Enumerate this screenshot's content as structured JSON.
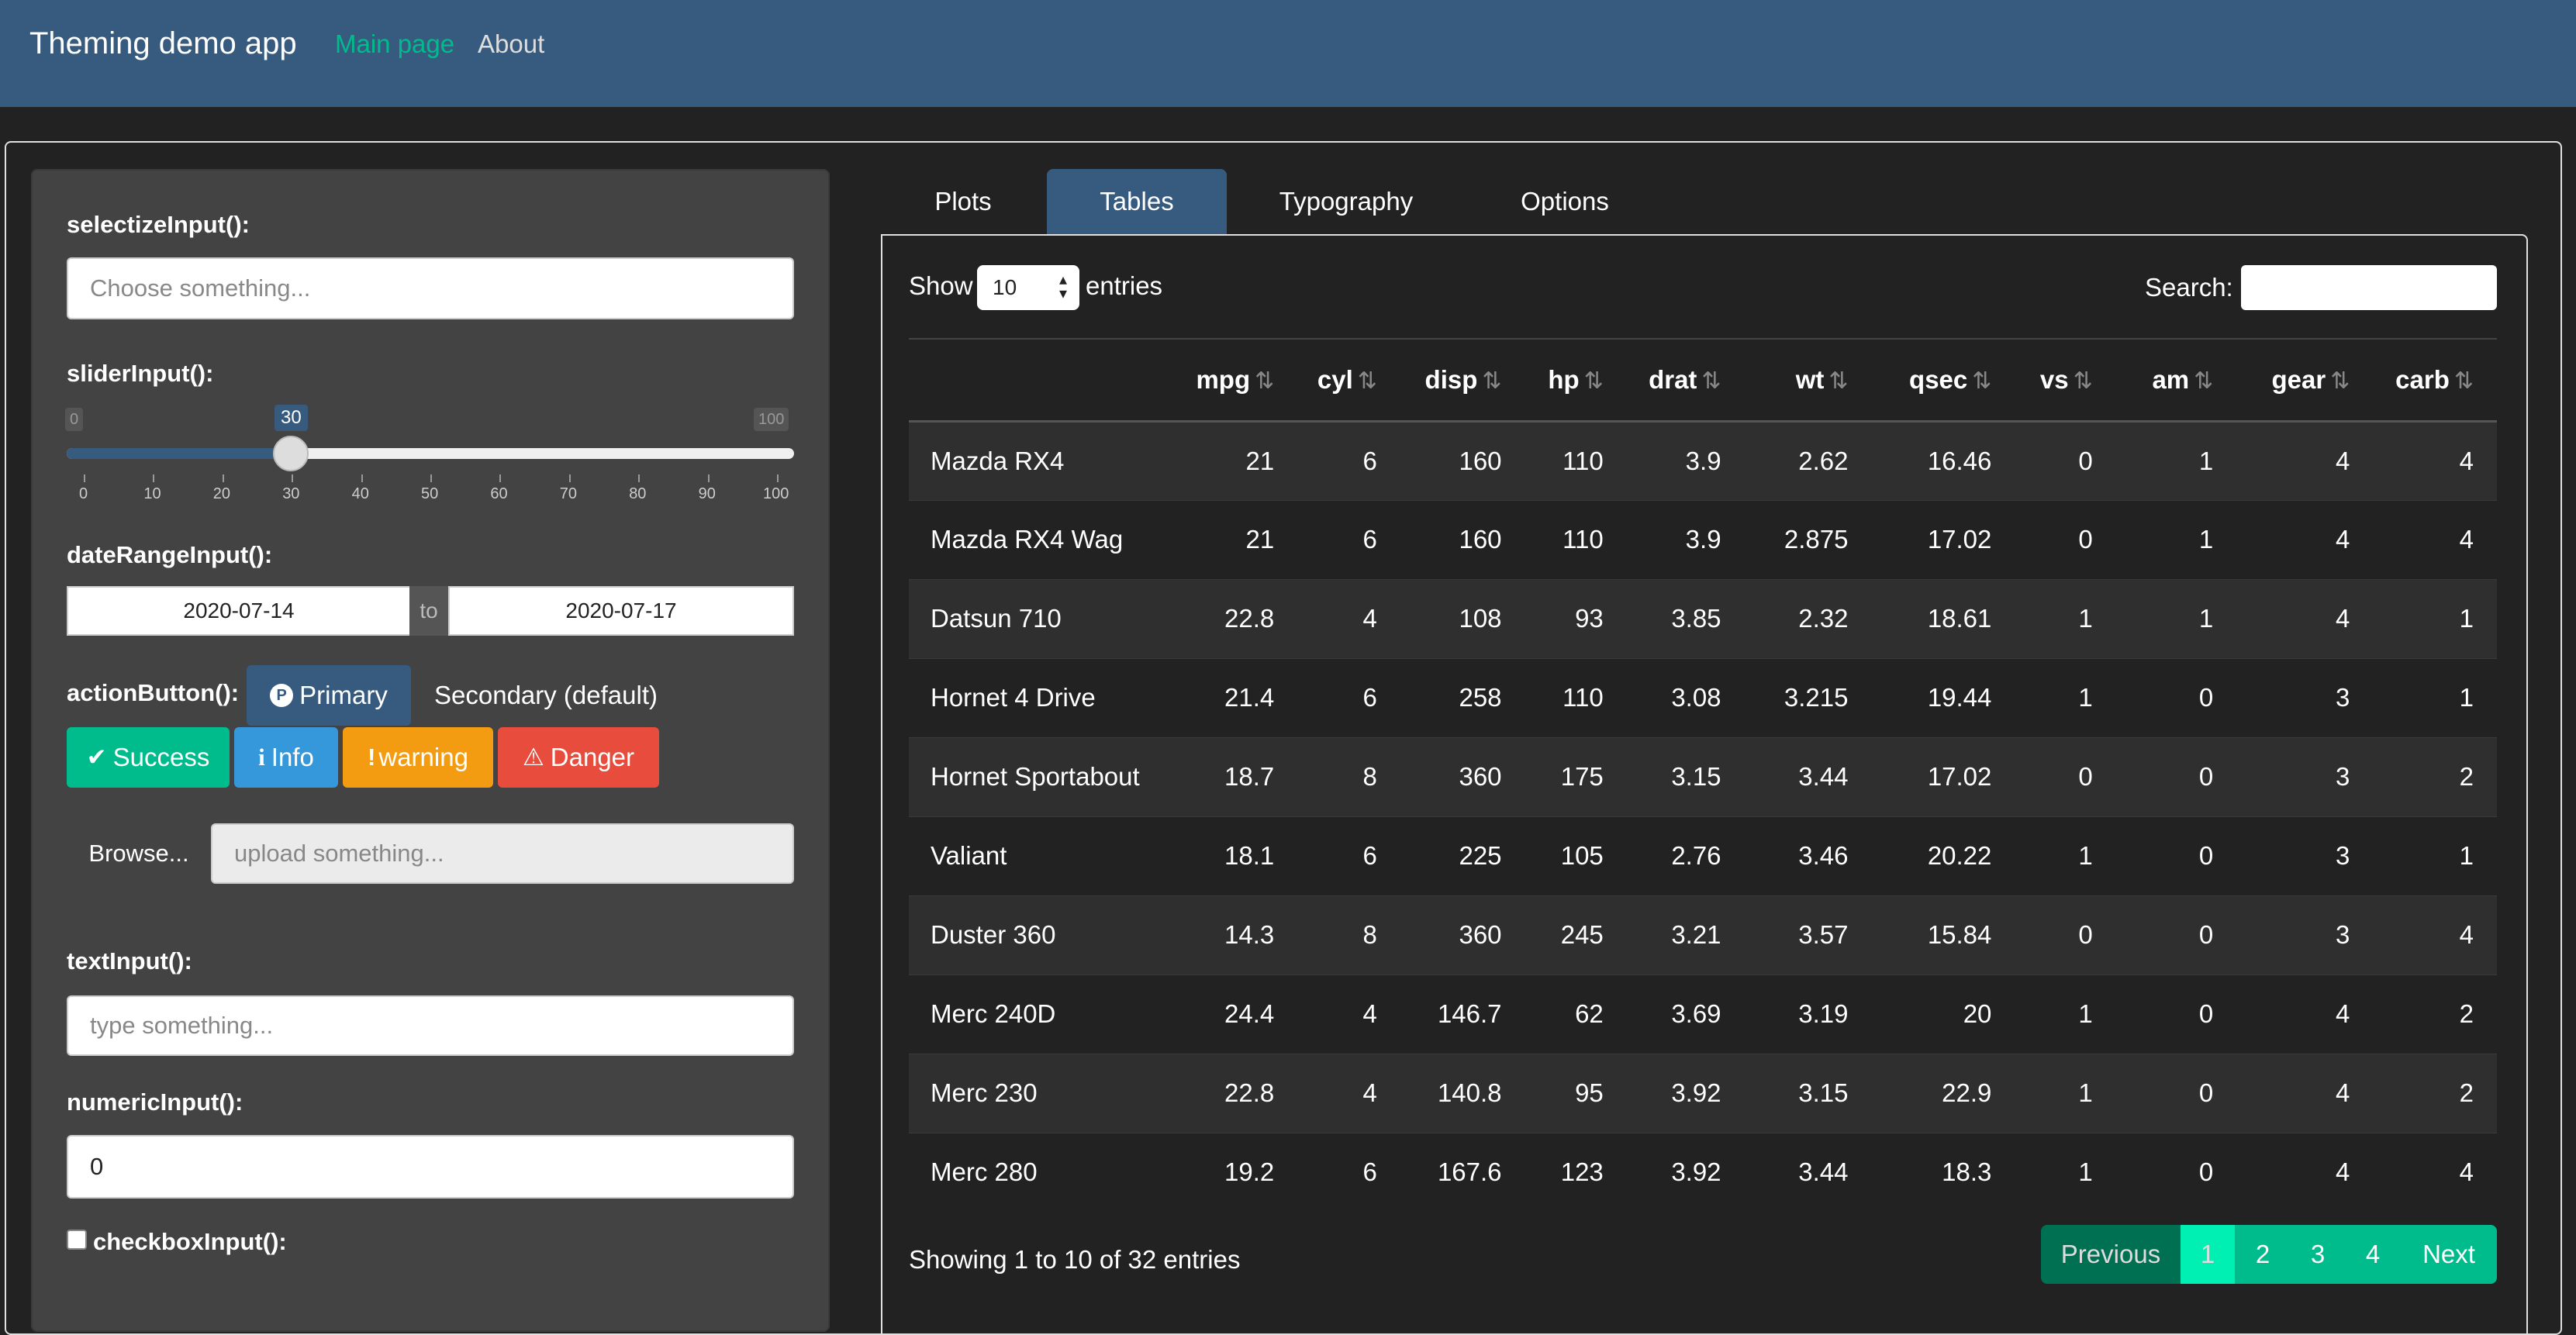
{
  "navbar": {
    "brand": "Theming demo app",
    "links": [
      "Main page",
      "About"
    ]
  },
  "sidebar": {
    "selectize_label": "selectizeInput():",
    "selectize_placeholder": "Choose something...",
    "slider_label": "sliderInput():",
    "slider": {
      "min": "0",
      "max": "100",
      "value": "30",
      "fraction": 0.3,
      "ticks": [
        "0",
        "10",
        "20",
        "30",
        "40",
        "50",
        "60",
        "70",
        "80",
        "90",
        "100"
      ]
    },
    "daterange_label": "dateRangeInput():",
    "date_start": "2020-07-14",
    "date_sep": "to",
    "date_end": "2020-07-17",
    "action_label": "actionButton():",
    "buttons": {
      "primary": "Primary",
      "secondary": "Secondary (default)",
      "success": "Success",
      "info": "Info",
      "warning": "warning",
      "danger": "Danger"
    },
    "browse_label": "Browse...",
    "upload_placeholder": "upload something...",
    "text_label": "textInput():",
    "text_placeholder": "type something...",
    "numeric_label": "numericInput():",
    "numeric_value": "0",
    "checkbox_label": "checkboxInput():"
  },
  "tabs": [
    "Plots",
    "Tables",
    "Typography",
    "Options"
  ],
  "active_tab": "Tables",
  "table_controls": {
    "show": "Show",
    "length": "10",
    "entries": "entries",
    "search": "Search:"
  },
  "table": {
    "columns": [
      "",
      "mpg",
      "cyl",
      "disp",
      "hp",
      "drat",
      "wt",
      "qsec",
      "vs",
      "am",
      "gear",
      "carb"
    ],
    "rows": [
      [
        "Mazda RX4",
        "21",
        "6",
        "160",
        "110",
        "3.9",
        "2.62",
        "16.46",
        "0",
        "1",
        "4",
        "4"
      ],
      [
        "Mazda RX4 Wag",
        "21",
        "6",
        "160",
        "110",
        "3.9",
        "2.875",
        "17.02",
        "0",
        "1",
        "4",
        "4"
      ],
      [
        "Datsun 710",
        "22.8",
        "4",
        "108",
        "93",
        "3.85",
        "2.32",
        "18.61",
        "1",
        "1",
        "4",
        "1"
      ],
      [
        "Hornet 4 Drive",
        "21.4",
        "6",
        "258",
        "110",
        "3.08",
        "3.215",
        "19.44",
        "1",
        "0",
        "3",
        "1"
      ],
      [
        "Hornet Sportabout",
        "18.7",
        "8",
        "360",
        "175",
        "3.15",
        "3.44",
        "17.02",
        "0",
        "0",
        "3",
        "2"
      ],
      [
        "Valiant",
        "18.1",
        "6",
        "225",
        "105",
        "2.76",
        "3.46",
        "20.22",
        "1",
        "0",
        "3",
        "1"
      ],
      [
        "Duster 360",
        "14.3",
        "8",
        "360",
        "245",
        "3.21",
        "3.57",
        "15.84",
        "0",
        "0",
        "3",
        "4"
      ],
      [
        "Merc 240D",
        "24.4",
        "4",
        "146.7",
        "62",
        "3.69",
        "3.19",
        "20",
        "1",
        "0",
        "4",
        "2"
      ],
      [
        "Merc 230",
        "22.8",
        "4",
        "140.8",
        "95",
        "3.92",
        "3.15",
        "22.9",
        "1",
        "0",
        "4",
        "2"
      ],
      [
        "Merc 280",
        "19.2",
        "6",
        "167.6",
        "123",
        "3.92",
        "3.44",
        "18.3",
        "1",
        "0",
        "4",
        "4"
      ]
    ]
  },
  "info": "Showing 1 to 10 of 32 entries",
  "pagination": [
    "Previous",
    "1",
    "2",
    "3",
    "4",
    "Next"
  ],
  "colors": {
    "navbar": "#375a7f",
    "accent": "#00bc8c",
    "info": "#3498db",
    "warning": "#f39c12",
    "danger": "#e74c3c",
    "background": "#222222"
  }
}
